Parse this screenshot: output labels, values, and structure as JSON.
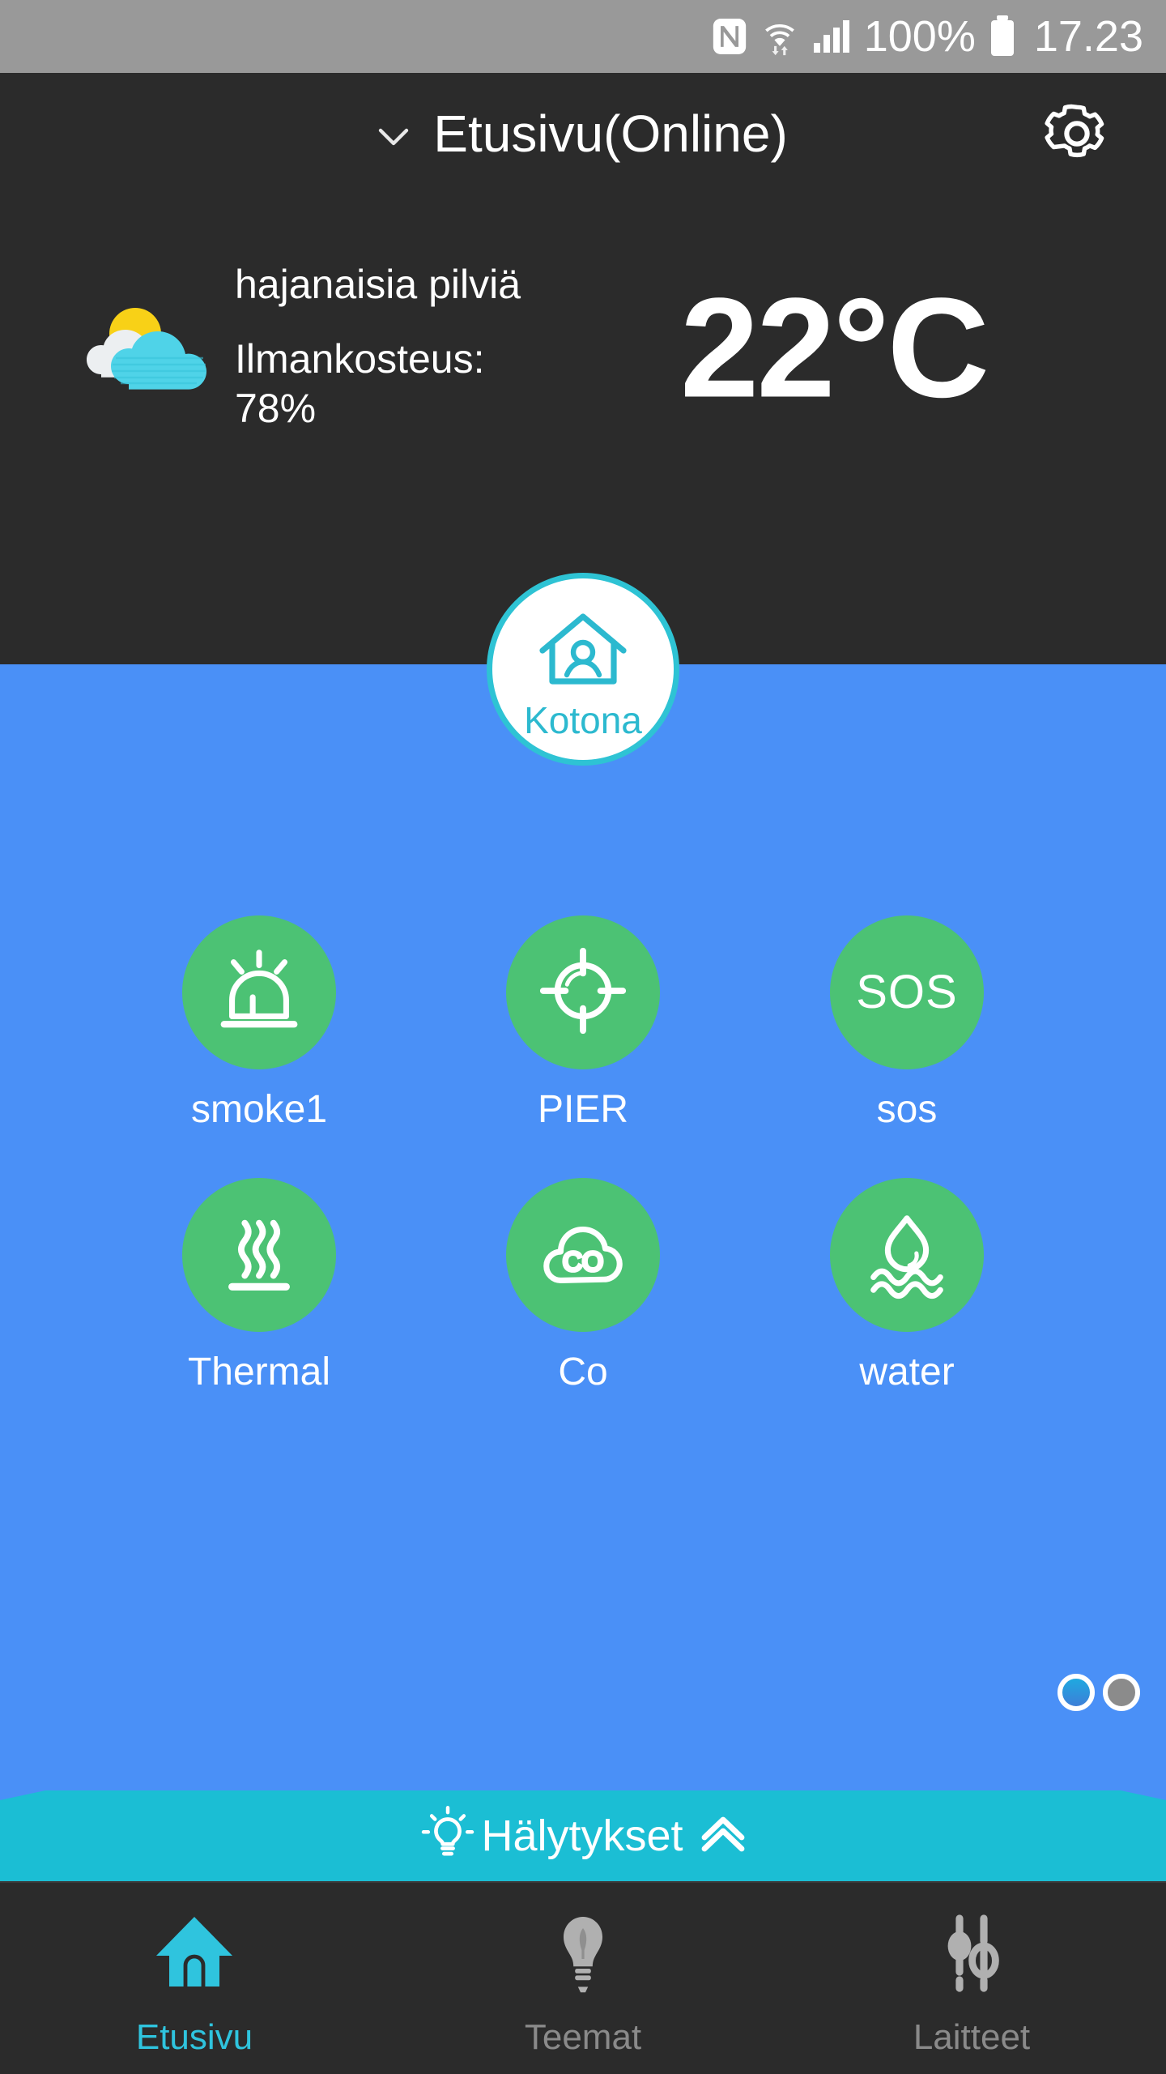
{
  "statusbar": {
    "battery_percent": "100%",
    "time": "17.23",
    "icons": [
      "nfc-icon",
      "wifi-icon",
      "signal-icon",
      "battery-icon"
    ]
  },
  "header": {
    "title": "Etusivu(Online)",
    "chevron": "chevron-down-icon",
    "settings": "gear-icon"
  },
  "weather": {
    "icon": "sun-behind-cloud-icon",
    "condition": "hajanaisia pilviä",
    "humidity_label": "Ilmankosteus:",
    "humidity_value": "78%",
    "temperature": "22°C"
  },
  "home_badge": {
    "label": "Kotona",
    "icon": "house-with-person-icon",
    "border_color": "#2ec3d4",
    "text_color": "#2cb9cf"
  },
  "devices": [
    {
      "label": "smoke1",
      "icon": "smoke-alarm-icon",
      "color": "#4cc274"
    },
    {
      "label": "PIER",
      "icon": "crosshair-target-icon",
      "color": "#4cc274"
    },
    {
      "label": "sos",
      "icon": "sos-icon",
      "icon_text": "SOS",
      "color": "#4cc274"
    },
    {
      "label": "Thermal",
      "icon": "heat-waves-icon",
      "color": "#4cc274"
    },
    {
      "label": "Co",
      "icon": "co-cloud-icon",
      "color": "#4cc274"
    },
    {
      "label": "water",
      "icon": "water-drop-icon",
      "color": "#4cc274"
    }
  ],
  "pagination": {
    "pages": 2,
    "current": 1
  },
  "alerts_bar": {
    "label": "Hälytykset",
    "left_icon": "lightbulb-icon",
    "right_icon": "chevron-up-icon",
    "background": "#1bbed4"
  },
  "bottom_nav": [
    {
      "label": "Etusivu",
      "icon": "home-icon",
      "active": true
    },
    {
      "label": "Teemat",
      "icon": "bulb-leaf-icon",
      "active": false
    },
    {
      "label": "Laitteet",
      "icon": "sliders-icon",
      "active": false
    }
  ],
  "colors": {
    "header_bg": "#2b2b2b",
    "panel_bg": "#4a90f7",
    "accent_green": "#4cc274",
    "accent_teal": "#1bbed4",
    "nav_active": "#2fc4de",
    "nav_inactive": "#8a8a8a",
    "statusbar_bg": "#999999"
  }
}
